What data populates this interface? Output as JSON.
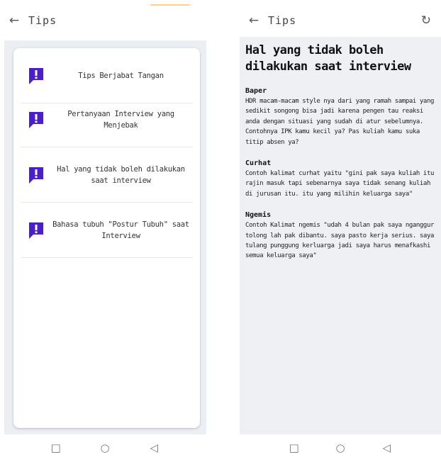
{
  "left": {
    "title": "Tips",
    "items": [
      {
        "label": "Tips Berjabat Tangan",
        "icon": "alert-message-icon"
      },
      {
        "label": "Pertanyaan Interview yang Menjebak",
        "icon": "alert-message-icon"
      },
      {
        "label": "Hal yang tidak boleh dilakukan saat interview",
        "icon": "alert-message-icon"
      },
      {
        "label": "Bahasa tubuh \"Postur Tubuh\" saat Interview",
        "icon": "alert-message-icon"
      }
    ]
  },
  "right": {
    "title": "Tips",
    "heading": "Hal yang tidak boleh dilakukan saat interview",
    "sections": [
      {
        "title": "Baper",
        "body": "HDR macam-macam style nya dari yang ramah sampai yang sedikit songong bisa jadi karena pengen tau reaksi anda dengan situasi yang sudah di atur sebelumnya. Contohnya IPK kamu kecil ya? Pas kuliah kamu suka titip absen ya?"
      },
      {
        "title": "Curhat",
        "body": "Contoh kalimat curhat yaitu \"gini pak saya kuliah itu rajin masuk tapi sebenarnya saya tidak senang kuliah di jurusan itu. itu yang milihin keluarga saya\""
      },
      {
        "title": "Ngemis",
        "body": "Contoh Kalimat ngemis \"udah 4 bulan pak saya nganggur tolong lah pak dibantu. saya pasto kerja serius. saya tulang punggung kerluarga jadi saya harus menafkashi semua keluarga saya\""
      }
    ]
  },
  "colors": {
    "accent": "#4a1ec8",
    "bg_gray": "#eef0f4"
  }
}
